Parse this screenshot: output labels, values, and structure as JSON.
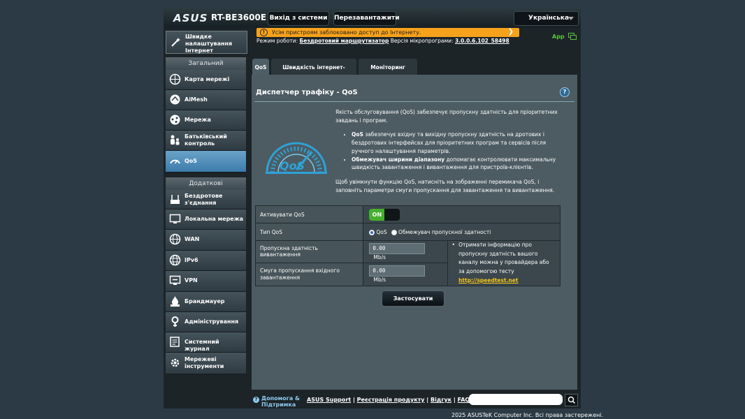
{
  "header": {
    "brand": "ASUS",
    "model": "RT-BE3600E",
    "logout_label": "Вихід з системи",
    "reboot_label": "Перезавантажити",
    "language": "Українська"
  },
  "sidebar": {
    "quick_setup": [
      "Швидке",
      "налаштування",
      "Інтернет"
    ],
    "section_general": "Загальний",
    "general_items": [
      {
        "label": "Карта мережі",
        "icon": "network-map-icon"
      },
      {
        "label": "AiMesh",
        "icon": "aimesh-icon"
      },
      {
        "label": "Мережа",
        "icon": "network-icon"
      },
      {
        "label": "Батьківський контроль",
        "icon": "parental-control-icon"
      },
      {
        "label": "QoS",
        "icon": "qos-icon"
      }
    ],
    "section_advanced": "Додаткові налаштування",
    "advanced_items": [
      {
        "label": "Бездротове з'єднання",
        "icon": "wireless-icon"
      },
      {
        "label": "Локальна мережа",
        "icon": "lan-icon"
      },
      {
        "label": "WAN",
        "icon": "wan-icon"
      },
      {
        "label": "IPv6",
        "icon": "ipv6-icon"
      },
      {
        "label": "VPN",
        "icon": "vpn-icon"
      },
      {
        "label": "Брандмауер",
        "icon": "firewall-icon"
      },
      {
        "label": "Адміністрування",
        "icon": "administration-icon"
      },
      {
        "label": "Системний журнал",
        "icon": "system-log-icon"
      },
      {
        "label": "Мережеві інструменти",
        "icon": "network-tools-icon"
      }
    ]
  },
  "alert": {
    "text": "Усім пристроям заблоковано доступ до Інтернету."
  },
  "status": {
    "mode_label": "Режим роботи:",
    "mode_value": "Бездротовий маршрутизатор",
    "firmware_label": "Версія мікропрограми:",
    "firmware_value": "3.0.0.6.102_58498",
    "app_label": "App"
  },
  "tabs": [
    "QoS",
    "Швидкість інтернет-з'єднання",
    "Моніторинг трафіку"
  ],
  "page": {
    "title": "Диспетчер трафіку - QoS",
    "intro": "Якість обслуговування (QoS) забезпечує пропускну здатність для пріоритетних завдань і програм.",
    "bullet1_bold": "QoS",
    "bullet1_rest": " забезпечує вхідну та вихідну пропускну здатність на дротових і бездротових інтерфейсах для пріоритетних програм та сервісів після ручного налаштування параметрів.",
    "bullet2_bold": "Обмежувач ширини діапазону",
    "bullet2_rest": " допомагає контролювати максимальну швидкість завантаження і вивантаження для пристроїв-клієнтів.",
    "outro": "Щоб увімкнути функцію QoS, натисніть на зображенні перемикача QoS, і заповніть параметри смуги пропускання для завантаження та вивантаження."
  },
  "settings": {
    "enable_label": "Активувати QoS",
    "enable_state": "ON",
    "type_label": "Тип QoS",
    "type_option1": "QoS",
    "type_option2": "Обмежувач пропускної здатності",
    "upload_label": "Пропускна здатність вивантаження",
    "upload_value": "0.00",
    "download_label": "Смуга пропускання вхідного завантаження",
    "download_value": "0.00",
    "unit": "Mb/s",
    "note_text": "Отримати інформацію про пропускну здатність вашого каналу можна у провайдера або за допомогою тесту",
    "note_link": "http://speedtest.net",
    "apply_label": "Застосувати"
  },
  "footer": {
    "help_label": "Допомога & Підтримка",
    "links": [
      "ASUS Support",
      "Реєстрація продукту",
      "Відгук",
      "FAQ"
    ],
    "copyright": "2025 ASUSTeK Computer Inc. Всі права застережені."
  }
}
